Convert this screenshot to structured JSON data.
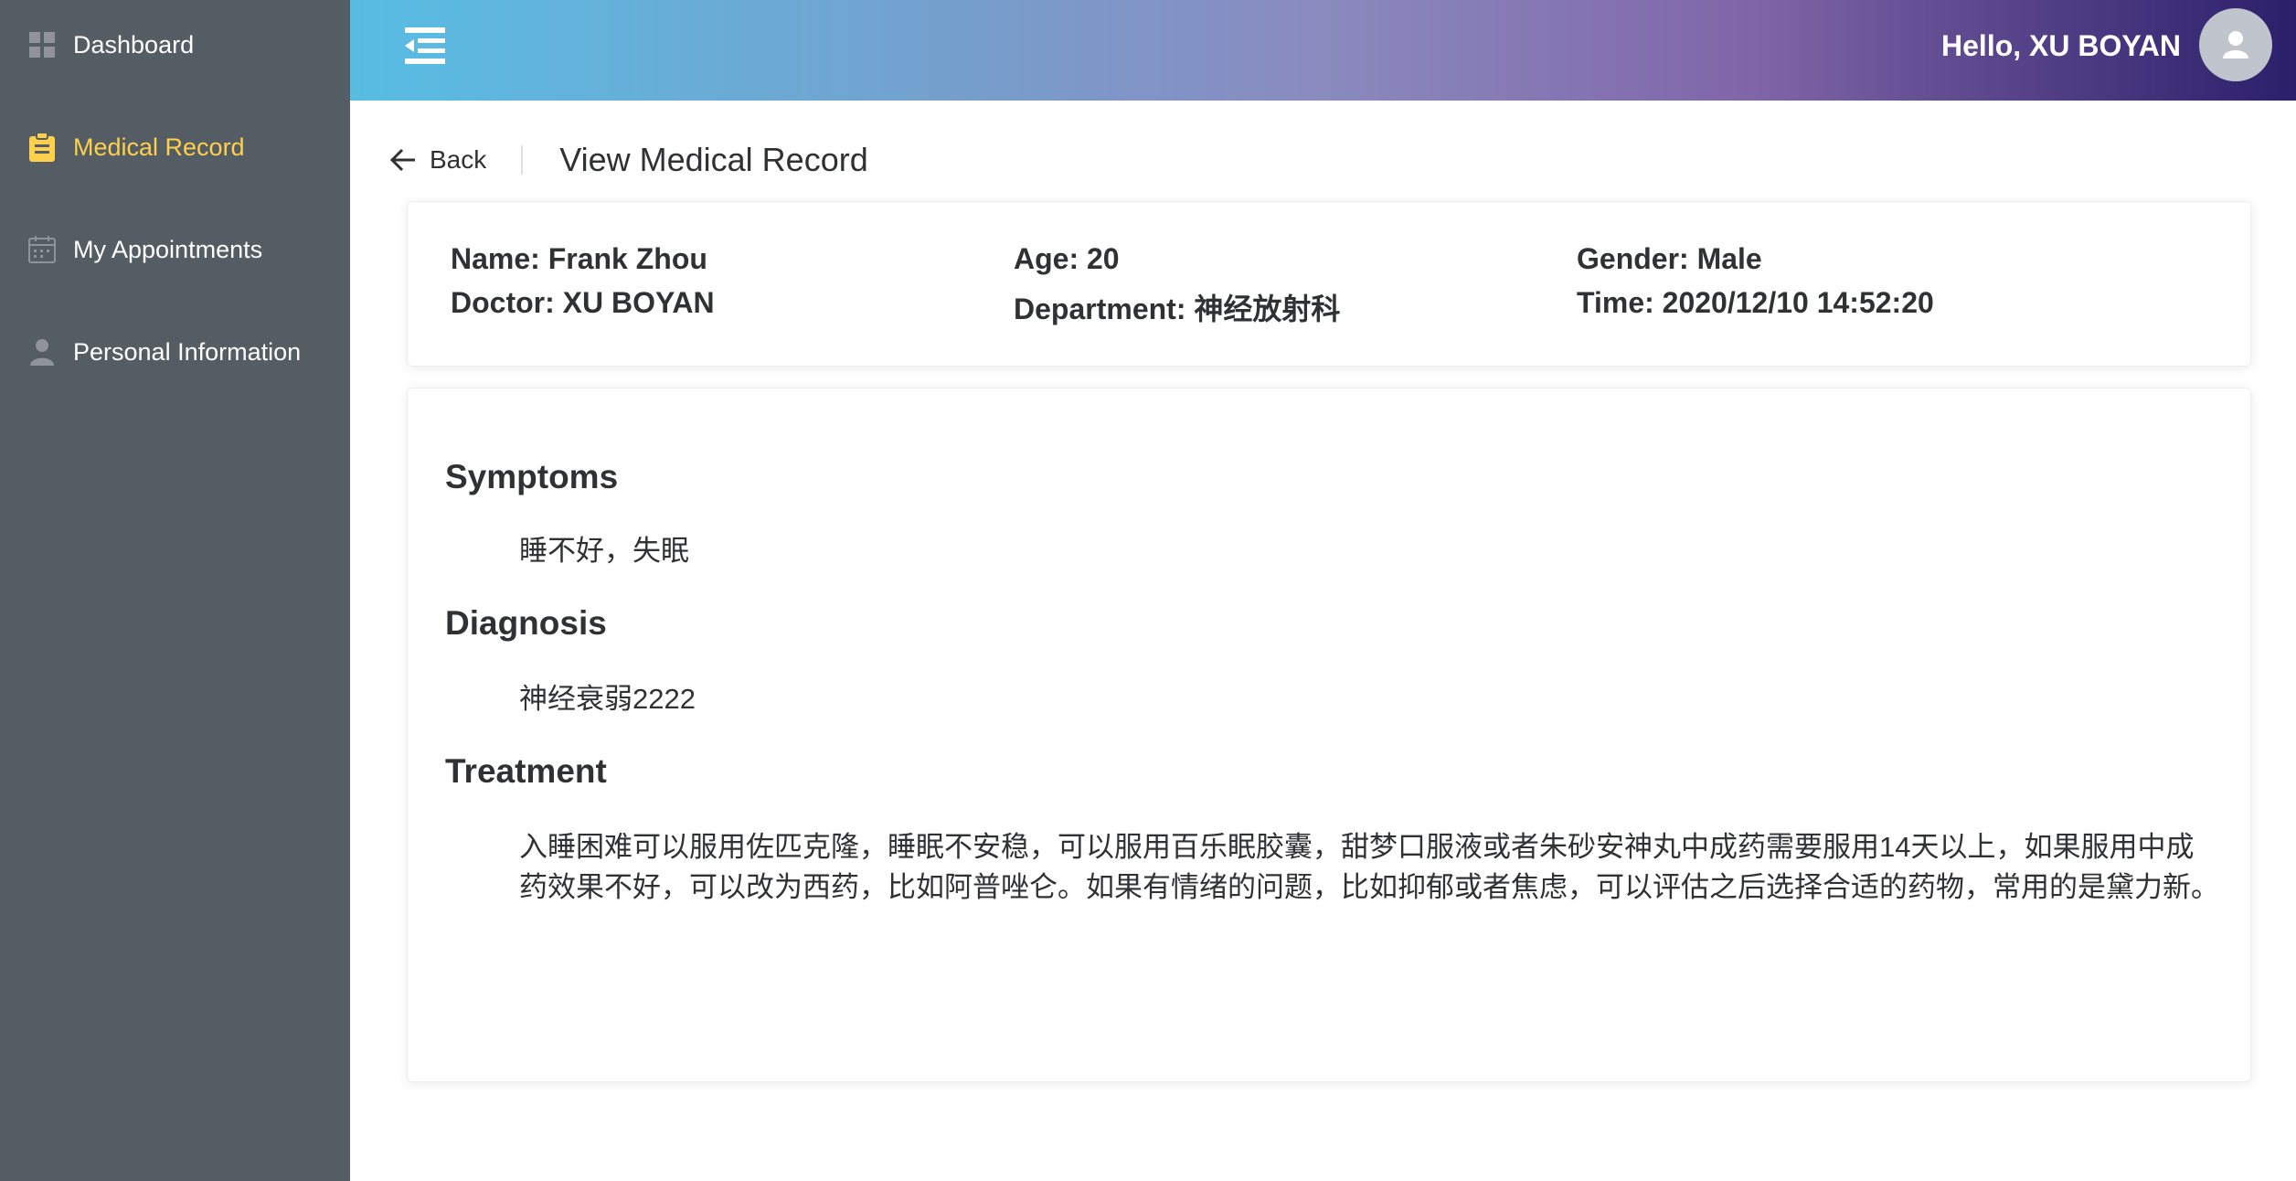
{
  "sidebar": {
    "items": [
      {
        "label": "Dashboard",
        "icon": "dashboard-icon"
      },
      {
        "label": "Medical Record",
        "icon": "clipboard-icon",
        "active": true
      },
      {
        "label": "My Appointments",
        "icon": "calendar-icon"
      },
      {
        "label": "Personal Information",
        "icon": "user-icon"
      }
    ]
  },
  "header": {
    "greeting": "Hello, XU BOYAN",
    "menu_icon": "menu-fold-icon",
    "avatar_icon": "user-avatar-icon"
  },
  "page": {
    "back_label": "Back",
    "title": "View Medical Record"
  },
  "info": {
    "name": "Name: Frank Zhou",
    "age": "Age: 20",
    "gender": "Gender: Male",
    "doctor": "Doctor: XU BOYAN",
    "department": "Department: 神经放射科",
    "time": "Time: 2020/12/10 14:52:20"
  },
  "record": {
    "symptoms_title": "Symptoms",
    "symptoms": "睡不好，失眠",
    "diagnosis_title": "Diagnosis",
    "diagnosis": "神经衰弱2222",
    "treatment_title": "Treatment",
    "treatment": "入睡困难可以服用佐匹克隆，睡眠不安稳，可以服用百乐眠胶囊，甜梦口服液或者朱砂安神丸中成药需要服用14天以上，如果服用中成药效果不好，可以改为西药，比如阿普唑仑。如果有情绪的问题，比如抑郁或者焦虑，可以评估之后选择合适的药物，常用的是黛力新。"
  },
  "colors": {
    "sidebar_bg": "#545c64",
    "active_text": "#ffd04b",
    "header_gradient_start": "#58bde3",
    "header_gradient_end": "#2b1f6a"
  }
}
